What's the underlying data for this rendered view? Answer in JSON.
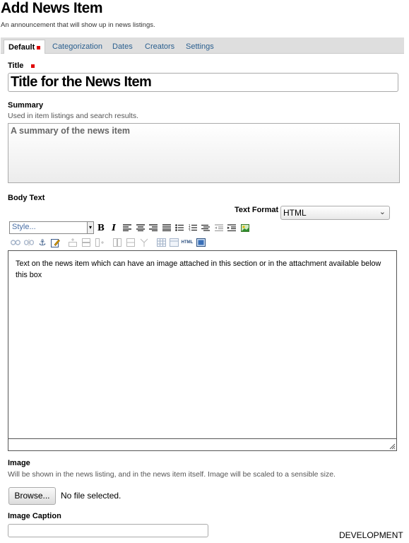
{
  "header": {
    "title": "Add News Item",
    "description": "An announcement that will show up in news listings."
  },
  "tabs": [
    {
      "label": "Default",
      "active": true,
      "required": true
    },
    {
      "label": "Categorization",
      "active": false
    },
    {
      "label": "Dates",
      "active": false
    },
    {
      "label": "Creators",
      "active": false
    },
    {
      "label": "Settings",
      "active": false
    }
  ],
  "fields": {
    "title": {
      "label": "Title",
      "required": true,
      "value": "Title for the News Item"
    },
    "summary": {
      "label": "Summary",
      "help": "Used in item listings and search results.",
      "value": "A summary of the news item"
    },
    "body": {
      "label": "Body Text",
      "text_format_label": "Text Format",
      "text_format_value": "HTML",
      "style_placeholder": "Style...",
      "content": "Text on the news item which can have an image attached in this section or in the attachment available below this box"
    },
    "image": {
      "label": "Image",
      "help": "Will be shown in the news listing, and in the news item itself. Image will be scaled to a sensible size.",
      "browse_label": "Browse...",
      "file_status": "No file selected."
    },
    "image_caption": {
      "label": "Image Caption",
      "value": ""
    }
  },
  "toolbar": {
    "row1": [
      "bold-icon",
      "italic-icon",
      "align-left-icon",
      "align-center-icon",
      "align-right-icon",
      "align-justify-icon",
      "bulleted-list-icon",
      "numbered-list-icon",
      "outdent-icon",
      "indent-icon",
      "definition-list-icon",
      "insert-image-icon"
    ],
    "row1_letters": {
      "bold": "B",
      "italic": "I"
    },
    "row2": [
      "link-icon",
      "unlink-icon",
      "anchor-icon",
      "edit-icon",
      "insert-row-icon",
      "delete-row-icon",
      "insert-col-icon",
      "delete-col-icon",
      "merge-icon",
      "split-icon",
      "table-icon",
      "table-properties-icon",
      "html-source-icon",
      "fullscreen-icon"
    ],
    "html_label": "HTML"
  },
  "environment_badge": "DEVELOPMENT",
  "colors": {
    "tab_link": "#2a5f8f",
    "required": "#e00000",
    "tabs_bg": "#dedede"
  }
}
